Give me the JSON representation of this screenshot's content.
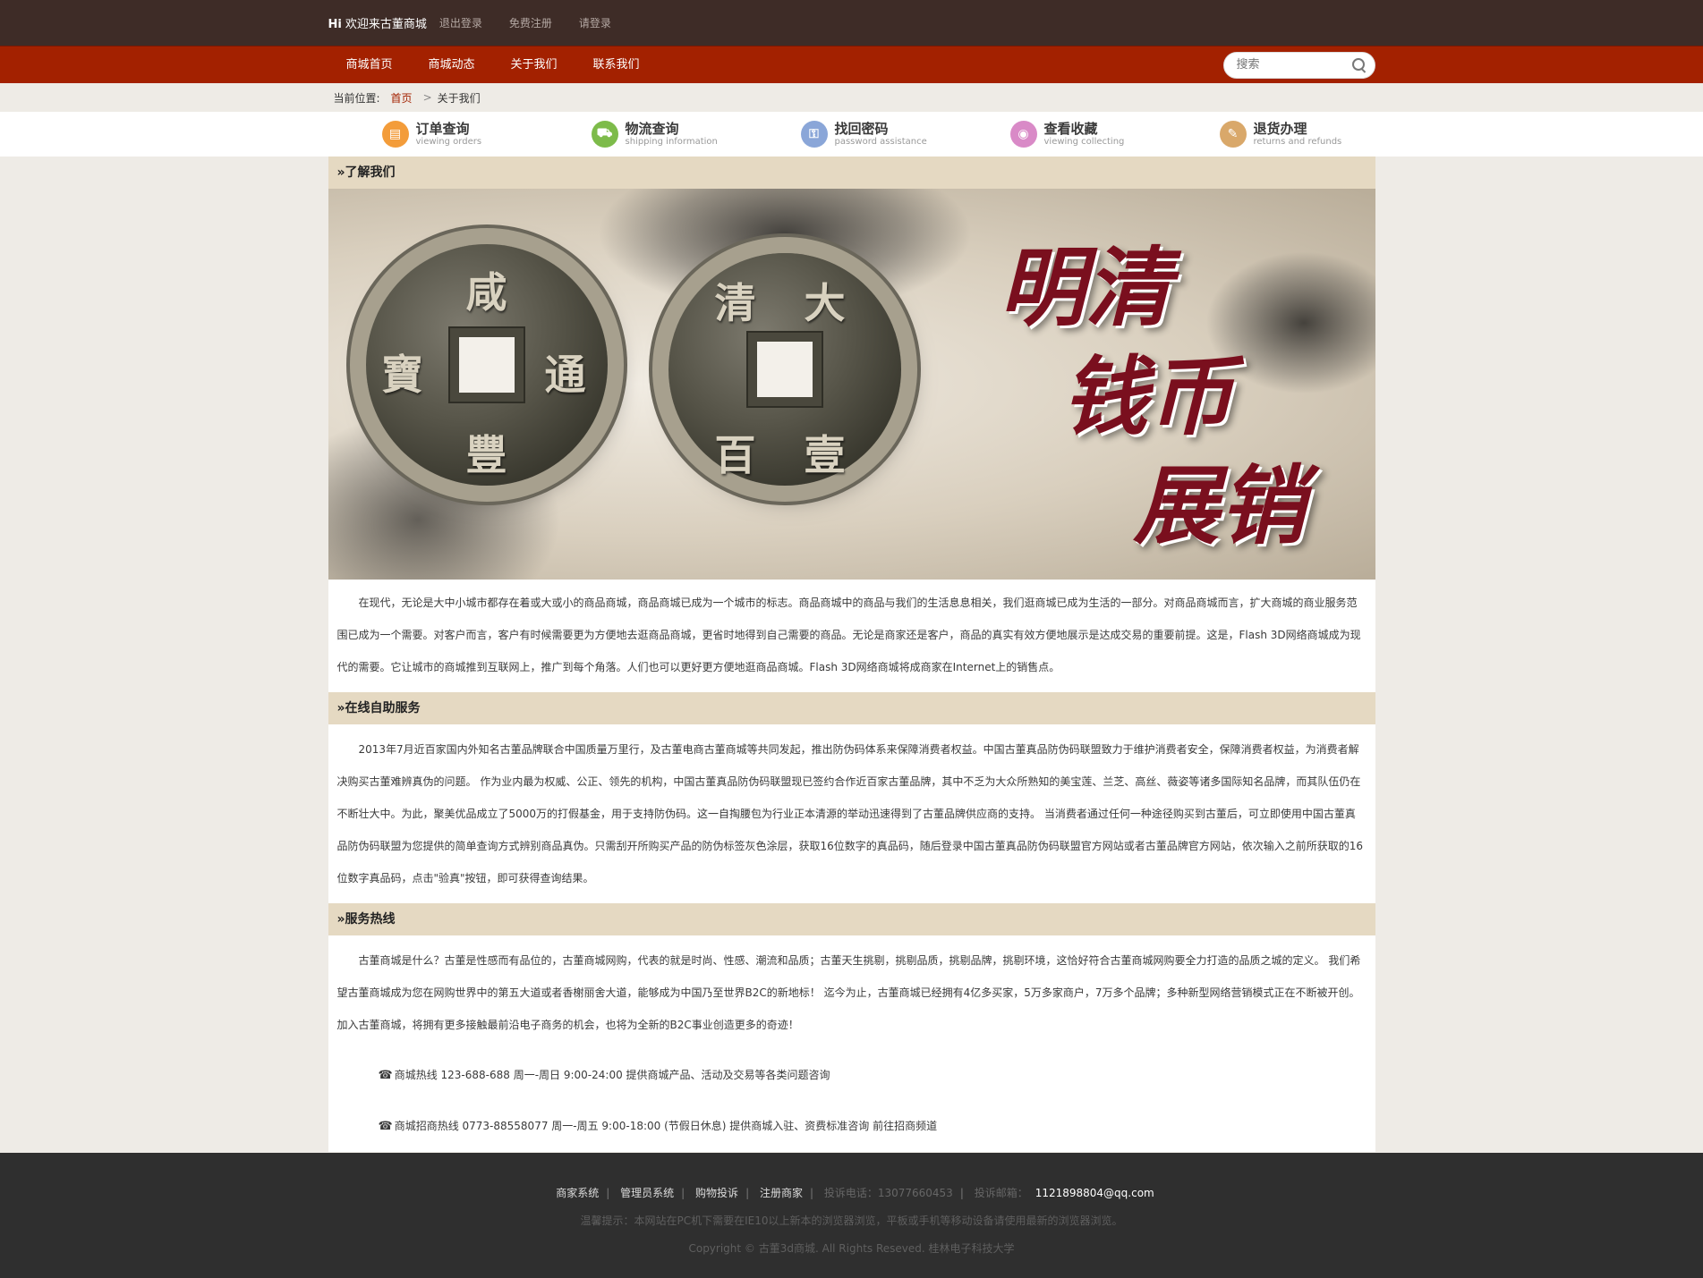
{
  "topbar": {
    "hi": "Hi",
    "greeting": "欢迎来古董商城",
    "links": [
      "退出登录",
      "免费注册",
      "请登录"
    ]
  },
  "nav": {
    "items": [
      "商城首页",
      "商城动态",
      "关于我们",
      "联系我们"
    ],
    "search_placeholder": "搜索"
  },
  "breadcrumb": {
    "label": "当前位置:",
    "home": "首页",
    "sep": ">",
    "current": "关于我们"
  },
  "services": [
    {
      "cn": "订单查询",
      "en": "viewing orders",
      "color": "#f39c3a",
      "icon": "document-icon",
      "glyph": "▤"
    },
    {
      "cn": "物流查询",
      "en": "shipping information",
      "color": "#7dbb4a",
      "icon": "truck-icon",
      "glyph": "⛟"
    },
    {
      "cn": "找回密码",
      "en": "password assistance",
      "color": "#8aa6d8",
      "icon": "key-icon",
      "glyph": "⚿"
    },
    {
      "cn": "查看收藏",
      "en": "viewing collecting",
      "color": "#d98ac7",
      "icon": "rss-icon",
      "glyph": "◉"
    },
    {
      "cn": "退货办理",
      "en": "returns and refunds",
      "color": "#d9a86a",
      "icon": "return-icon",
      "glyph": "✎"
    }
  ],
  "sections": {
    "about_title": "»了解我们",
    "banner": {
      "coin1": [
        "咸",
        "通",
        "豐",
        "寶"
      ],
      "coin2": [
        "清",
        "大",
        "壹",
        "百"
      ],
      "slogan": [
        "明清",
        "钱币",
        "展销"
      ]
    },
    "about_text": "在现代，无论是大中小城市都存在着或大或小的商品商城，商品商城已成为一个城市的标志。商品商城中的商品与我们的生活息息相关，我们逛商城已成为生活的一部分。对商品商城而言，扩大商城的商业服务范围已成为一个需要。对客户而言，客户有时候需要更为方便地去逛商品商城，更省时地得到自己需要的商品。无论是商家还是客户，商品的真实有效方便地展示是达成交易的重要前提。这是，Flash 3D网络商城成为现代的需要。它让城市的商城推到互联网上，推广到每个角落。人们也可以更好更方便地逛商品商城。Flash 3D网络商城将成商家在Internet上的销售点。",
    "self_title": "»在线自助服务",
    "self_text": "2013年7月近百家国内外知名古董品牌联合中国质量万里行，及古董电商古董商城等共同发起，推出防伪码体系来保障消费者权益。中国古董真品防伪码联盟致力于维护消费者安全，保障消费者权益，为消费者解决购买古董难辨真伪的问题。 作为业内最为权威、公正、领先的机构，中国古董真品防伪码联盟现已签约合作近百家古董品牌，其中不乏为大众所熟知的美宝莲、兰芝、高丝、薇姿等诸多国际知名品牌，而其队伍仍在不断壮大中。为此，聚美优品成立了5000万的打假基金，用于支持防伪码。这一自掏腰包为行业正本清源的举动迅速得到了古董品牌供应商的支持。 当消费者通过任何一种途径购买到古董后，可立即使用中国古董真品防伪码联盟为您提供的简单查询方式辨别商品真伪。只需刮开所购买产品的防伪标签灰色涂层，获取16位数字的真品码，随后登录中国古董真品防伪码联盟官方网站或者古董品牌官方网站，依次输入之前所获取的16位数字真品码，点击\"验真\"按钮，即可获得查询结果。",
    "hotline_title": "»服务热线",
    "hotline_text": "古董商城是什么？古董是性感而有品位的，古董商城网购，代表的就是时尚、性感、潮流和品质；古董天生挑剔，挑剔品质，挑剔品牌，挑剔环境，这恰好符合古董商城网购要全力打造的品质之城的定义。 我们希望古董商城成为您在网购世界中的第五大道或者香榭丽舍大道，能够成为中国乃至世界B2C的新地标！ 迄今为止，古董商城已经拥有4亿多买家，5万多家商户，7万多个品牌；多种新型网络营销模式正在不断被开创。加入古董商城，将拥有更多接触最前沿电子商务的机会，也将为全新的B2C事业创造更多的奇迹！",
    "hotlines": [
      "商城热线 123-688-688 周一-周日 9:00-24:00 提供商城产品、活动及交易等各类问题咨询",
      "商城招商热线 0773-88558077 周一-周五 9:00-18:00 (节假日休息) 提供商城入驻、资费标准咨询 前往招商频道"
    ]
  },
  "footer": {
    "links": [
      "商家系统",
      "管理员系统",
      "购物投诉",
      "注册商家"
    ],
    "phone_label": "投诉电话：13077660453",
    "email_label": "投诉邮箱：",
    "email": "1121898804@qq.com",
    "tip": "温馨提示：本网站在PC机下需要在IE10以上新本的浏览器浏览，平板或手机等移动设备请使用最新的浏览器浏览。",
    "copyright": "Copyright © 古董3d商城. All Rights Reseved. 桂林电子科技大学"
  }
}
